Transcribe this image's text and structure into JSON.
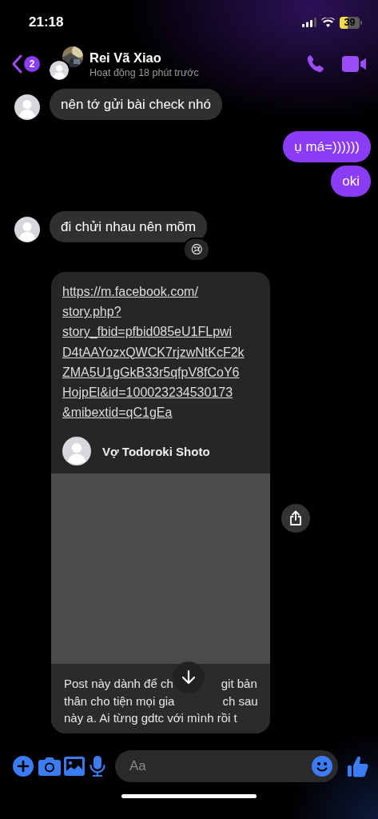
{
  "status_bar": {
    "time": "21:18",
    "battery": "39",
    "low_power": true
  },
  "header": {
    "unread_count": "2",
    "name": "Rei Vã Xiao",
    "status": "Hoạt động 18 phút trước"
  },
  "messages": [
    {
      "kind": "received",
      "text": "nên tớ gửi bài check nhó"
    },
    {
      "kind": "sent",
      "text": "ụ má=))))))"
    },
    {
      "kind": "sent",
      "text": "oki"
    },
    {
      "kind": "received",
      "text": "đi chửi nhau nên mõm",
      "reaction": "😢"
    },
    {
      "kind": "link",
      "url_lines": [
        "https://m.facebook.com/",
        "story.php?",
        "story_fbid=pfbid085eU1FLpwi",
        "D4tAAYozxQWCK7rjzwNtKcF2k",
        "ZMA5U1gGkB33r5qfpV8fCoY6",
        "HojpEl&id=100023234530173",
        "&mibextid=qC1gEa"
      ],
      "author": "Vợ Todoroki Shoto",
      "post_lines": [
        [
          "Post này dành để ch",
          "git bản"
        ],
        [
          "thân cho tiện mọi gia",
          "ch sau"
        ],
        [
          "này a. Ai từng gdtc với mình rồi t"
        ]
      ]
    }
  ],
  "composer": {
    "placeholder": "Aa"
  }
}
